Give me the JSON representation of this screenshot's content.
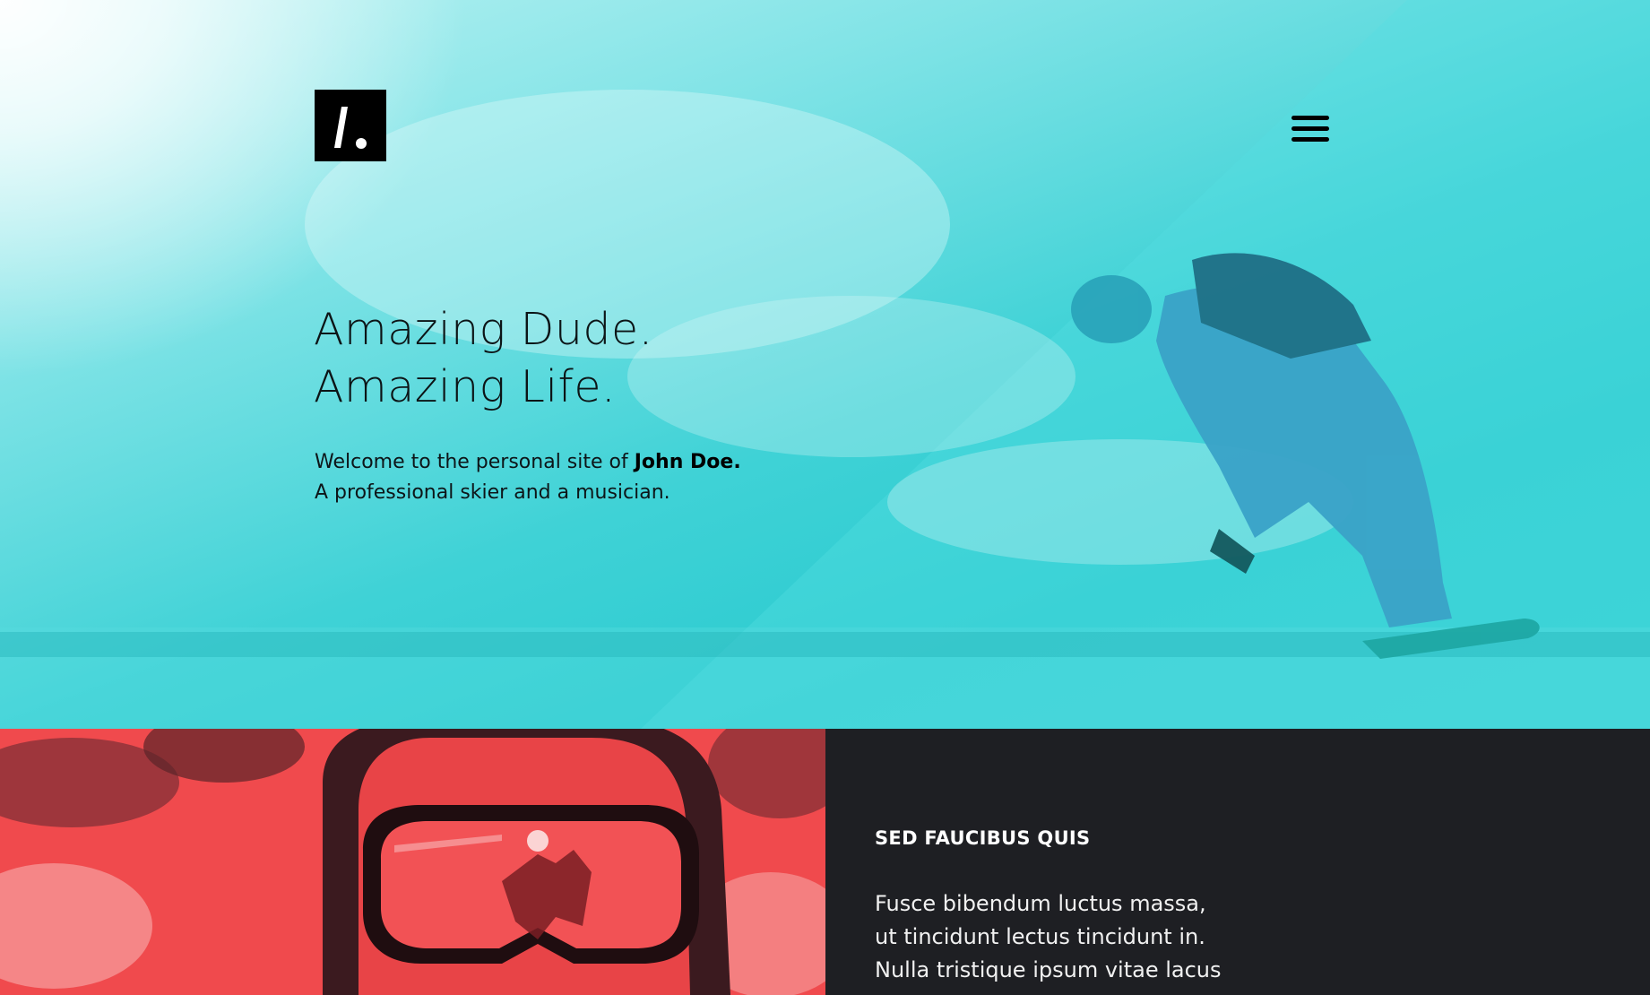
{
  "logo": {
    "glyph": "/.",
    "icon": "slash-dot-logo-icon"
  },
  "menu": {
    "icon": "hamburger-menu-icon"
  },
  "hero": {
    "title_lines": [
      "Amazing Dude.",
      "Amazing Life."
    ],
    "intro_prefix": "Welcome to the personal site of ",
    "intro_name": "John Doe.",
    "intro_line2": "A professional skier and a musician.",
    "accent_color": "#2ccbd0"
  },
  "feature": {
    "photo_accent": "#f04a4d",
    "heading": "SED FAUCIBUS QUIS",
    "body_lines": [
      "Fusce bibendum luctus massa,",
      "ut tincidunt lectus tincidunt in.",
      "Nulla tristique ipsum vitae lacus"
    ]
  }
}
